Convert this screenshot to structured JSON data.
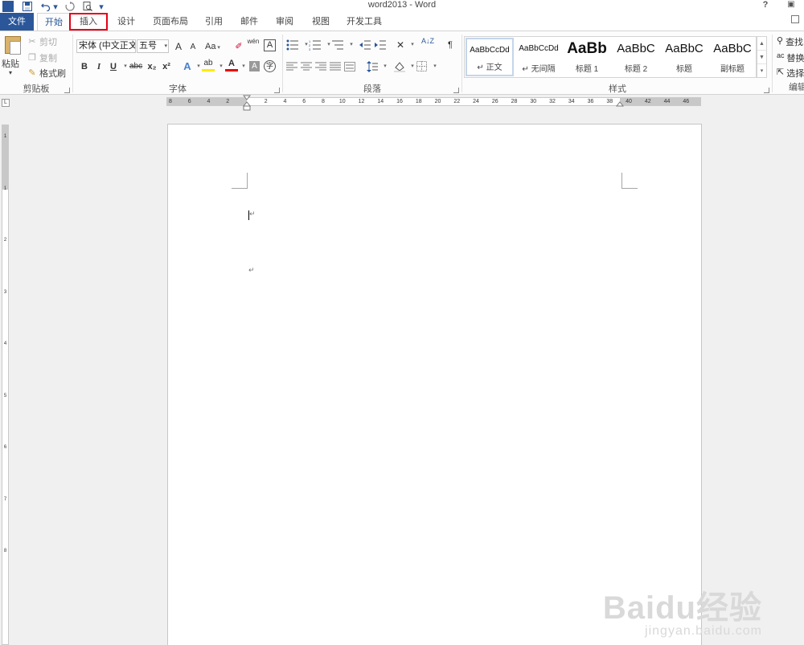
{
  "window": {
    "title": "word2013 - Word",
    "help_label": "?",
    "app_logo_text": "W"
  },
  "qat": {
    "save_icon": "save-icon",
    "undo_icon": "undo-icon",
    "redo_icon": "redo-icon",
    "preview_icon": "print-preview-icon",
    "customize_icon": "customize-qat-icon"
  },
  "tabs": [
    {
      "label": "文件"
    },
    {
      "label": "开始"
    },
    {
      "label": "插入"
    },
    {
      "label": "设计"
    },
    {
      "label": "页面布局"
    },
    {
      "label": "引用"
    },
    {
      "label": "邮件"
    },
    {
      "label": "审阅"
    },
    {
      "label": "视图"
    },
    {
      "label": "开发工具"
    }
  ],
  "ribbon": {
    "clipboard": {
      "group_label": "剪贴板",
      "paste_label": "粘贴",
      "cut_label": "剪切",
      "copy_label": "复制",
      "format_painter_label": "格式刷"
    },
    "font": {
      "group_label": "字体",
      "font_name": "宋体 (中文正文",
      "font_size": "五号",
      "grow_label": "A",
      "shrink_label": "A",
      "case_label": "Aa",
      "phonetic_label": "wén",
      "border_char_label": "A",
      "bold_label": "B",
      "italic_label": "I",
      "underline_label": "U",
      "strike_label": "abc",
      "subscript_label": "x₂",
      "superscript_label": "x²",
      "text_effect_label": "A",
      "highlight_label": "ab",
      "font_color_label": "A",
      "shading_label": "A",
      "enclose_label": "字"
    },
    "paragraph": {
      "group_label": "段落",
      "sort_label": "A↓Z"
    },
    "styles": {
      "group_label": "样式",
      "items": [
        {
          "preview": "AaBbCcDd",
          "name": "↵ 正文"
        },
        {
          "preview": "AaBbCcDd",
          "name": "↵ 无间隔"
        },
        {
          "preview": "AaBb",
          "name": "标题 1"
        },
        {
          "preview": "AaBbC",
          "name": "标题 2"
        },
        {
          "preview": "AaBbC",
          "name": "标题"
        },
        {
          "preview": "AaBbC",
          "name": "副标题"
        }
      ]
    },
    "editing": {
      "group_label": "编辑",
      "find_label": "查找",
      "replace_label": "替换",
      "select_label": "选择"
    }
  },
  "ruler": {
    "h_numbers": [
      "8",
      "6",
      "4",
      "2",
      "",
      "2",
      "4",
      "6",
      "8",
      "10",
      "12",
      "14",
      "16",
      "18",
      "20",
      "22",
      "24",
      "26",
      "28",
      "30",
      "32",
      "34",
      "36",
      "38",
      "40",
      "42",
      "44",
      "46"
    ],
    "v_numbers": [
      "1",
      "1",
      "2",
      "3",
      "4",
      "5",
      "6",
      "7",
      "8"
    ],
    "corner_label": "L"
  },
  "document": {
    "paragraph_mark": "↵"
  },
  "watermark": {
    "logo": "Baidu经验",
    "url": "jingyan.baidu.com"
  }
}
